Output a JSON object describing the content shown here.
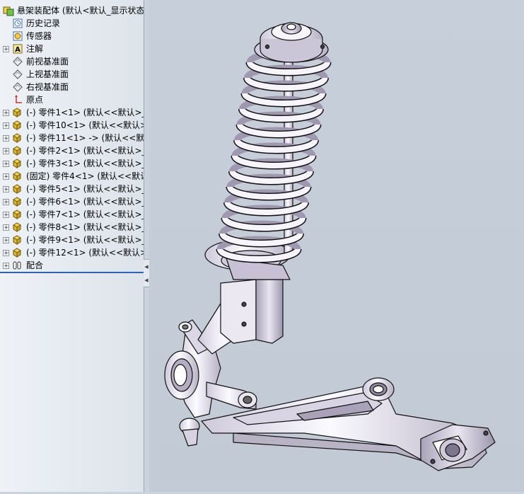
{
  "tree": {
    "root": {
      "label": "悬架装配体  (默认<默认_显示状态"
    },
    "items": [
      {
        "label": "历史记录",
        "icon": "history-icon",
        "expandable": false
      },
      {
        "label": "传感器",
        "icon": "sensor-icon",
        "expandable": false
      },
      {
        "label": "注解",
        "icon": "annotation-icon",
        "expandable": true
      },
      {
        "label": "前视基准面",
        "icon": "plane-icon",
        "expandable": false
      },
      {
        "label": "上视基准面",
        "icon": "plane-icon",
        "expandable": false
      },
      {
        "label": "右视基准面",
        "icon": "plane-icon",
        "expandable": false
      },
      {
        "label": "原点",
        "icon": "origin-icon",
        "expandable": false
      },
      {
        "label": "(-) 零件1<1> (默认<<默认>_",
        "icon": "part-icon",
        "expandable": true
      },
      {
        "label": "(-) 零件10<1> (默认<<默认>_",
        "icon": "part-icon",
        "expandable": true
      },
      {
        "label": "(-) 零件11<1> -> (默认<<默",
        "icon": "part-icon",
        "expandable": true
      },
      {
        "label": "(-) 零件2<1> (默认<<默认>_",
        "icon": "part-icon",
        "expandable": true
      },
      {
        "label": "(-) 零件3<1> (默认<<默认>_",
        "icon": "part-icon",
        "expandable": true
      },
      {
        "label": "(固定) 零件4<1> (默认<<默认",
        "icon": "part-icon",
        "expandable": true
      },
      {
        "label": "(-) 零件5<1> (默认<<默认>_",
        "icon": "part-icon",
        "expandable": true
      },
      {
        "label": "(-) 零件6<1> (默认<<默认>_",
        "icon": "part-icon",
        "expandable": true
      },
      {
        "label": "(-) 零件7<1> (默认<<默认>_",
        "icon": "part-icon",
        "expandable": true
      },
      {
        "label": "(-) 零件8<1> (默认<<默认>_",
        "icon": "part-icon",
        "expandable": true
      },
      {
        "label": "(-) 零件9<1> (默认<<默认>_",
        "icon": "part-icon",
        "expandable": true
      },
      {
        "label": "(-) 零件12<1> (默认<<默认>",
        "icon": "part-icon",
        "expandable": true
      },
      {
        "label": "配合",
        "icon": "mates-icon",
        "expandable": true
      }
    ]
  },
  "colors": {
    "selection_line": "#2b63b8",
    "viewport_bg": "#c7cfdb",
    "part_fill": "#f2f0f6",
    "part_shade": "#b9b3c6"
  }
}
